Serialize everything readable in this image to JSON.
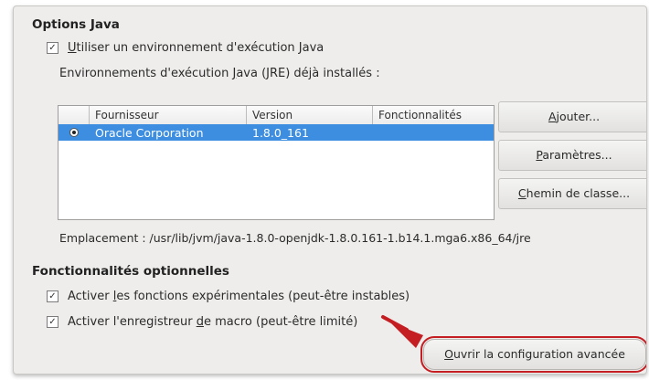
{
  "java_options": {
    "title": "Options Java",
    "use_jre": {
      "checked": true,
      "label_prefix": "U",
      "label_rest": "tiliser un environnement d'exécution Java"
    },
    "installed_label_prefix": "Environnements d'exécution ",
    "installed_label_ul": "J",
    "installed_label_rest": "ava (JRE) déjà installés :",
    "table": {
      "columns": [
        "Fournisseur",
        "Version",
        "Fonctionnalités"
      ],
      "rows": [
        {
          "selected": true,
          "vendor": "Oracle Corporation",
          "version": "1.8.0_161",
          "features": ""
        }
      ]
    },
    "buttons": {
      "add_ul": "A",
      "add_rest": "jouter...",
      "params_ul": "P",
      "params_rest": "aramètres...",
      "classpath_ul": "C",
      "classpath_rest": "hemin de classe..."
    },
    "location": "Emplacement : /usr/lib/jvm/java-1.8.0-openjdk-1.8.0.161-1.b14.1.mga6.x86_64/jre"
  },
  "optional_features": {
    "title": "Fonctionnalités optionnelles",
    "experimental": {
      "checked": true,
      "label_prefix": "Activer ",
      "label_ul": "l",
      "label_rest": "es fonctions expérimentales (peut-être instables)"
    },
    "macro": {
      "checked": true,
      "label_prefix": "Activer l'enregistreur ",
      "label_ul": "d",
      "label_rest": "e macro (peut-être limité)"
    },
    "advanced_button": {
      "label_ul": "O",
      "label_rest": "uvrir la configuration avancée"
    }
  },
  "colors": {
    "selection": "#3d8ee0",
    "highlight": "#c41e23",
    "panel": "#eeedeb"
  }
}
